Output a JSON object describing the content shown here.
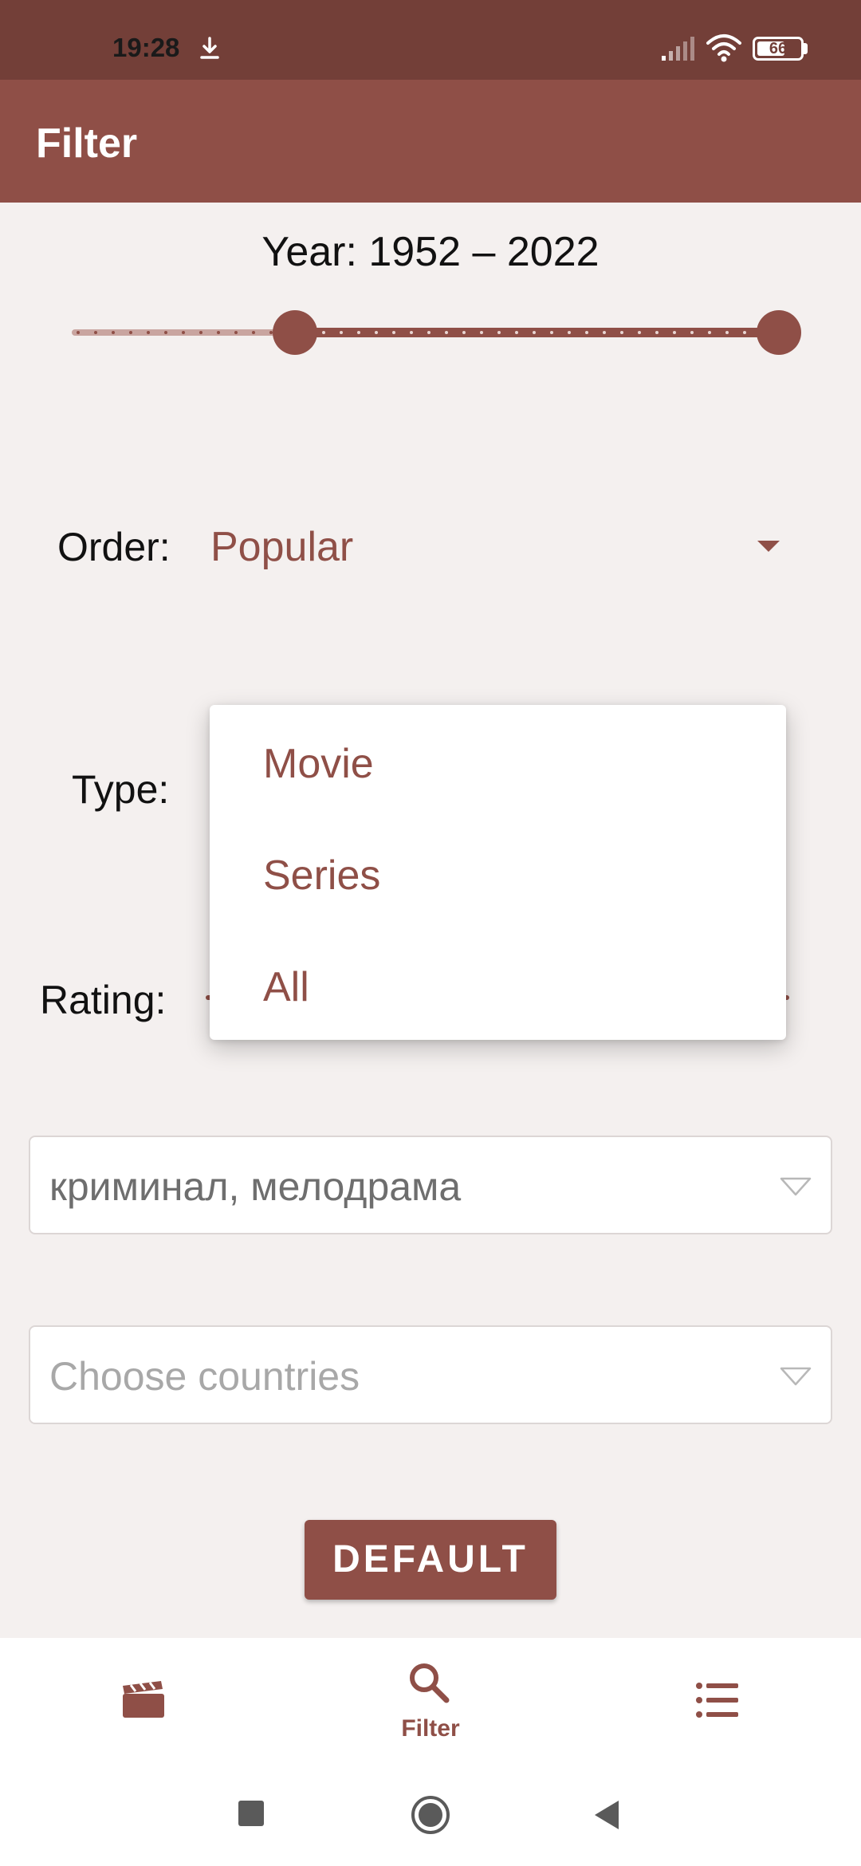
{
  "status_bar": {
    "time": "19:28",
    "battery": "66",
    "battery_level": 0.66,
    "icons": [
      "download-icon",
      "signal-icon",
      "wifi-icon",
      "battery-icon"
    ]
  },
  "app_bar": {
    "title": "Filter"
  },
  "year_filter": {
    "text": "Year: 1952 – 2022",
    "min": 1952,
    "max": 2022
  },
  "order": {
    "label": "Order:",
    "value": "Popular"
  },
  "type": {
    "label": "Type:",
    "options": [
      "Movie",
      "Series",
      "All"
    ]
  },
  "rating": {
    "label": "Rating:"
  },
  "genres": {
    "value": "криминал, мелодрама"
  },
  "countries": {
    "placeholder": "Choose countries"
  },
  "default_button": {
    "label": "DEFAULT"
  },
  "bottom_nav": {
    "items": [
      {
        "icon": "movie-clapper-icon",
        "label": ""
      },
      {
        "icon": "search-icon",
        "label": "Filter"
      },
      {
        "icon": "list-icon",
        "label": ""
      }
    ]
  },
  "colors": {
    "status_bar": "#733f38",
    "primary": "#8f4f47",
    "background": "#f4f0ef",
    "slider_inactive": "#c9a5a0"
  }
}
